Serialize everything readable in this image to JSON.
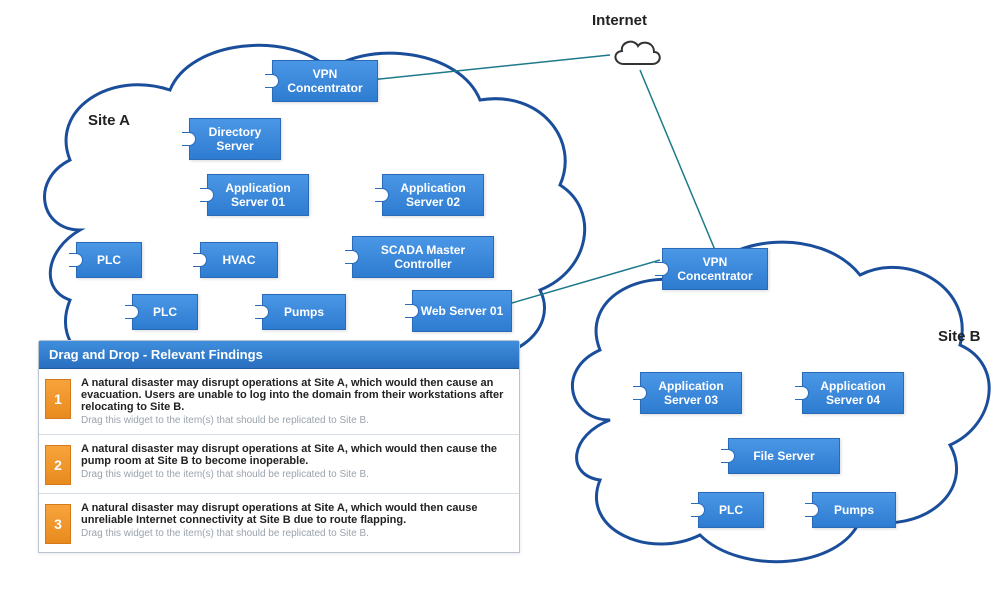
{
  "labels": {
    "internet": "Internet",
    "siteA": "Site A",
    "siteB": "Site B"
  },
  "nodes": {
    "vpnA": "VPN Concentrator",
    "dirServer": "Directory Server",
    "app01": "Application Server 01",
    "app02": "Application Server 02",
    "plc1": "PLC",
    "hvac": "HVAC",
    "scada": "SCADA Master Controller",
    "plc2": "PLC",
    "pumps1": "Pumps",
    "web01": "Web Server 01",
    "vpnB": "VPN Concentrator",
    "app03": "Application Server 03",
    "app04": "Application Server 04",
    "fileServer": "File Server",
    "plc3": "PLC",
    "pumps2": "Pumps"
  },
  "panel": {
    "title": "Drag and Drop - Relevant Findings",
    "hint": "Drag this widget to the item(s) that should be replicated to Site B.",
    "items": [
      {
        "num": "1",
        "text": "A natural disaster may disrupt operations at Site A, which would then cause an evacuation. Users are unable to log into the domain from their workstations after relocating to Site B."
      },
      {
        "num": "2",
        "text": "A natural disaster may disrupt operations at Site A, which would then cause the pump room at Site B to become inoperable."
      },
      {
        "num": "3",
        "text": "A natural disaster may disrupt operations at Site A, which would then cause unreliable Internet connectivity at Site B due to route flapping."
      }
    ]
  }
}
